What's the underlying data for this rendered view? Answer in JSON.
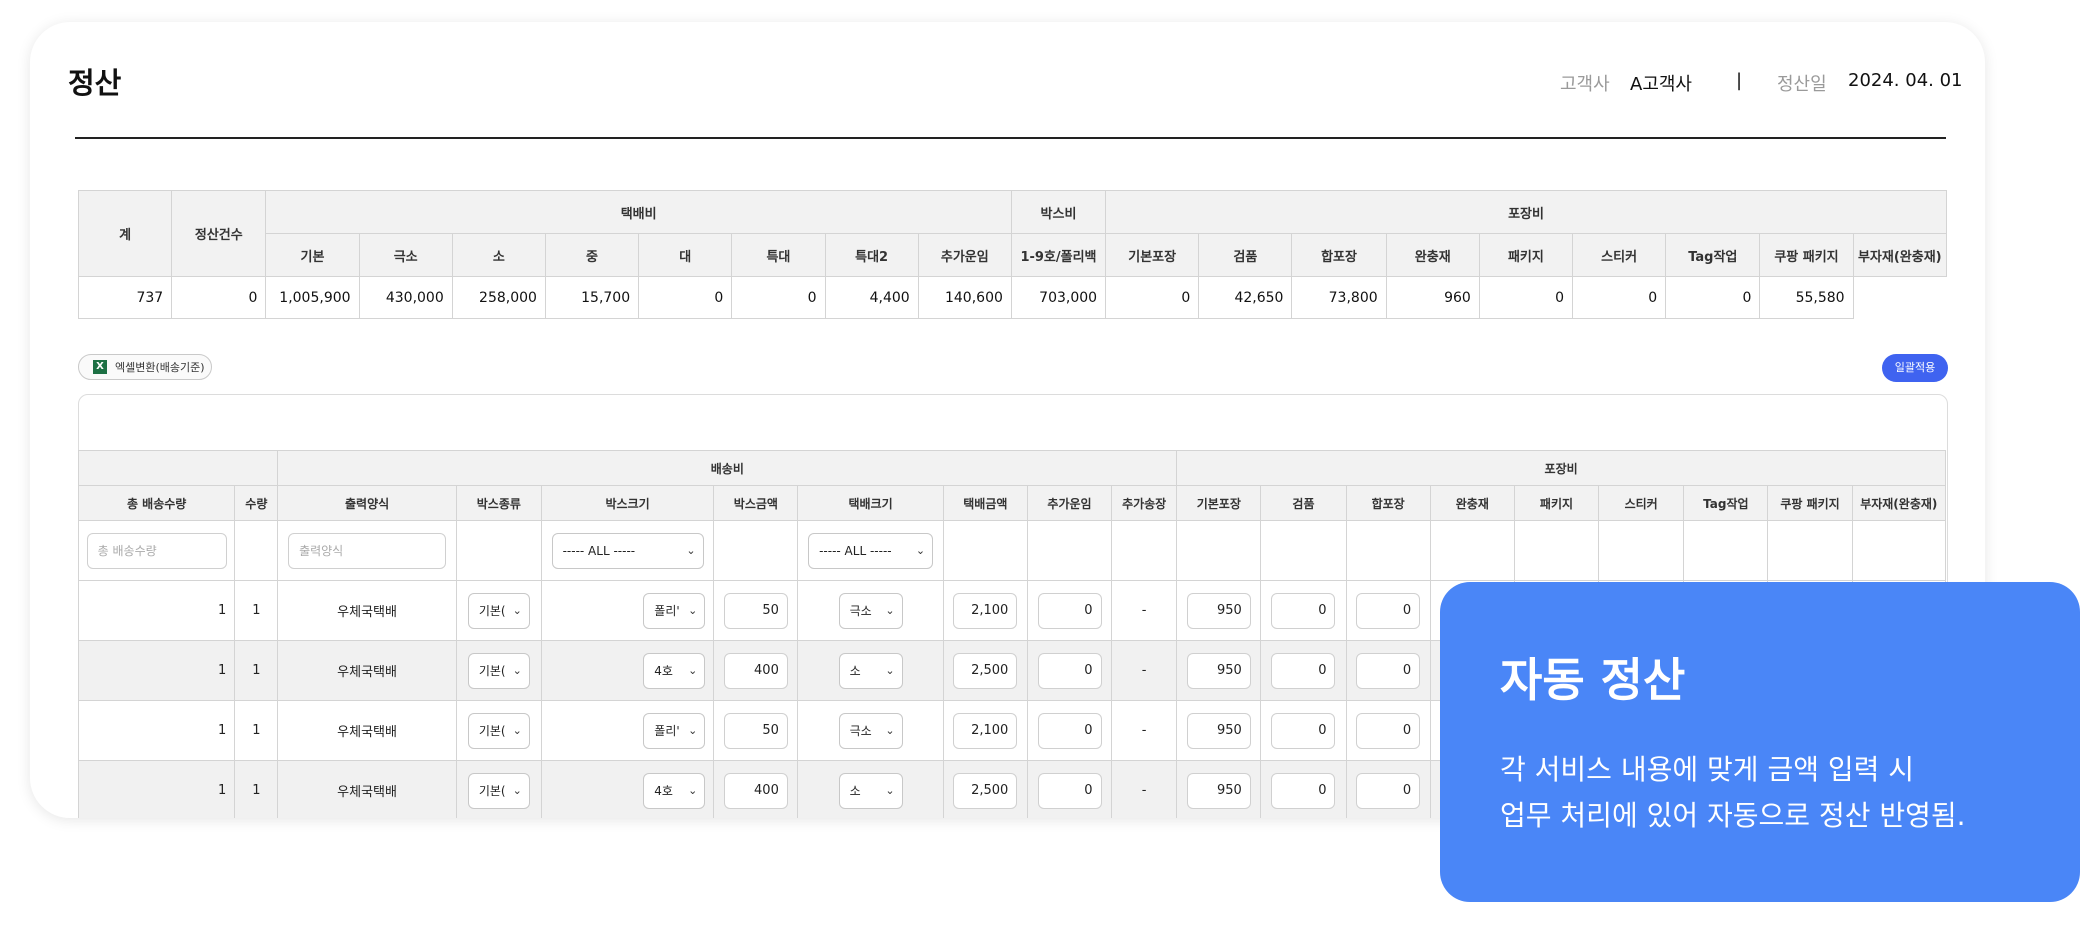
{
  "header": {
    "title": "정산",
    "client_label": "고객사",
    "client_value": "A고객사",
    "separator": "|",
    "date_label": "정산일",
    "date_value": "2024. 04. 01"
  },
  "summary": {
    "total_label": "계",
    "count_label": "정산건수",
    "group_delivery": "택배비",
    "group_box": "박스비",
    "group_packing": "포장비",
    "columns": [
      "기본",
      "극소",
      "소",
      "중",
      "대",
      "특대",
      "특대2",
      "추가운임",
      "1-9호/폴리백",
      "기본포장",
      "검품",
      "합포장",
      "완충재",
      "패키지",
      "스티커",
      "Tag작업",
      "쿠팡 패키지",
      "부자재(완충재)"
    ],
    "count_value": "737",
    "values": [
      "0",
      "1,005,900",
      "430,000",
      "258,000",
      "15,700",
      "0",
      "0",
      "4,400",
      "140,600",
      "703,000",
      "0",
      "42,650",
      "73,800",
      "960",
      "0",
      "0",
      "0",
      "55,580"
    ]
  },
  "toolbar": {
    "excel_label": "엑셀변환(배송기준)",
    "excel_icon": "X",
    "apply_label": "일괄적용"
  },
  "detail": {
    "group_shipping": "배송비",
    "group_packing": "포장비",
    "columns": [
      "총 배송수량",
      "수량",
      "출력양식",
      "박스종류",
      "박스크기",
      "박스금액",
      "택배크기",
      "택배금액",
      "추가운임",
      "추가송장",
      "기본포장",
      "검품",
      "합포장",
      "완충재",
      "패키지",
      "스티커",
      "Tag작업",
      "쿠팡 패키지",
      "부자재(완충재)"
    ],
    "filter_total_placeholder": "총 배송수량",
    "filter_form_placeholder": "출력양식",
    "filter_boxsize": "----- ALL -----",
    "filter_parcel": "----- ALL -----",
    "rows": [
      {
        "total": "1",
        "qty": "1",
        "form": "우체국택배",
        "boxtype": "기본(",
        "boxsize": "폴리'",
        "boxamt": "50",
        "parcel": "극소",
        "parcelamt": "2,100",
        "extra": "0",
        "extra_inv": "-",
        "basic": "950",
        "inspect": "0",
        "combine": "0"
      },
      {
        "total": "1",
        "qty": "1",
        "form": "우체국택배",
        "boxtype": "기본(",
        "boxsize": "4호",
        "boxamt": "400",
        "parcel": "소",
        "parcelamt": "2,500",
        "extra": "0",
        "extra_inv": "-",
        "basic": "950",
        "inspect": "0",
        "combine": "0"
      },
      {
        "total": "1",
        "qty": "1",
        "form": "우체국택배",
        "boxtype": "기본(",
        "boxsize": "폴리'",
        "boxamt": "50",
        "parcel": "극소",
        "parcelamt": "2,100",
        "extra": "0",
        "extra_inv": "-",
        "basic": "950",
        "inspect": "0",
        "combine": "0"
      },
      {
        "total": "1",
        "qty": "1",
        "form": "우체국택배",
        "boxtype": "기본(",
        "boxsize": "4호",
        "boxamt": "400",
        "parcel": "소",
        "parcelamt": "2,500",
        "extra": "0",
        "extra_inv": "-",
        "basic": "950",
        "inspect": "0",
        "combine": "0"
      }
    ]
  },
  "overlay": {
    "heading": "자동 정산",
    "line1": "각 서비스 내용에 맞게 금액 입력 시",
    "line2": "업무 처리에 있어 자동으로 정산 반영됨.",
    "color": "#4a86f7"
  },
  "icons": {
    "select_chevron": "chevron-down-icon",
    "excel": "excel-icon"
  }
}
